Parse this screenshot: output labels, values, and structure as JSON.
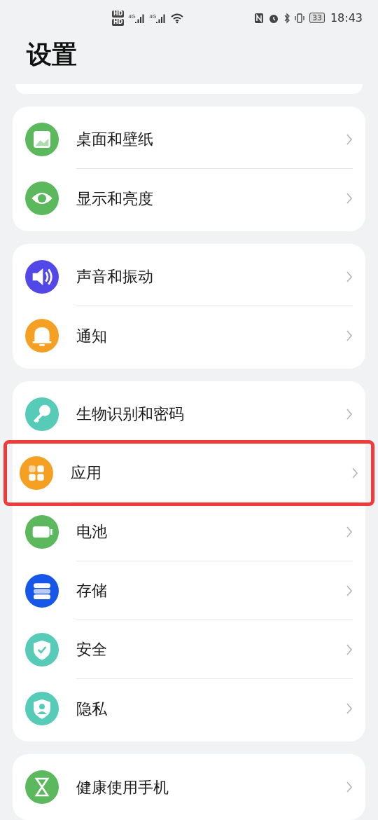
{
  "status_bar": {
    "sim_labels": [
      "HD",
      "HD"
    ],
    "network": [
      "4G",
      "4G"
    ],
    "battery": "33",
    "time": "18:43"
  },
  "title": "设置",
  "groups": [
    {
      "items": [
        {
          "label": "桌面和壁纸",
          "kind": "image",
          "color": "#5cb85c",
          "highlighted": false
        },
        {
          "label": "显示和亮度",
          "kind": "eye",
          "color": "#5cb85c",
          "highlighted": false
        }
      ]
    },
    {
      "items": [
        {
          "label": "声音和振动",
          "kind": "sound",
          "color": "#5248e8",
          "highlighted": false
        },
        {
          "label": "通知",
          "kind": "bell",
          "color": "#f5a023",
          "highlighted": false
        }
      ]
    },
    {
      "items": [
        {
          "label": "生物识别和密码",
          "kind": "key",
          "color": "#56cbb8",
          "highlighted": false
        },
        {
          "label": "应用",
          "kind": "apps",
          "color": "#f5a023",
          "highlighted": true
        },
        {
          "label": "电池",
          "kind": "battery",
          "color": "#5cb85c",
          "highlighted": false
        },
        {
          "label": "存储",
          "kind": "storage",
          "color": "#1656e8",
          "highlighted": false
        },
        {
          "label": "安全",
          "kind": "shield",
          "color": "#56cbb8",
          "highlighted": false
        },
        {
          "label": "隐私",
          "kind": "privacy",
          "color": "#56cbb8",
          "highlighted": false
        }
      ]
    },
    {
      "items": [
        {
          "label": "健康使用手机",
          "kind": "hourglass",
          "color": "#5cb85c",
          "highlighted": false
        }
      ]
    }
  ]
}
